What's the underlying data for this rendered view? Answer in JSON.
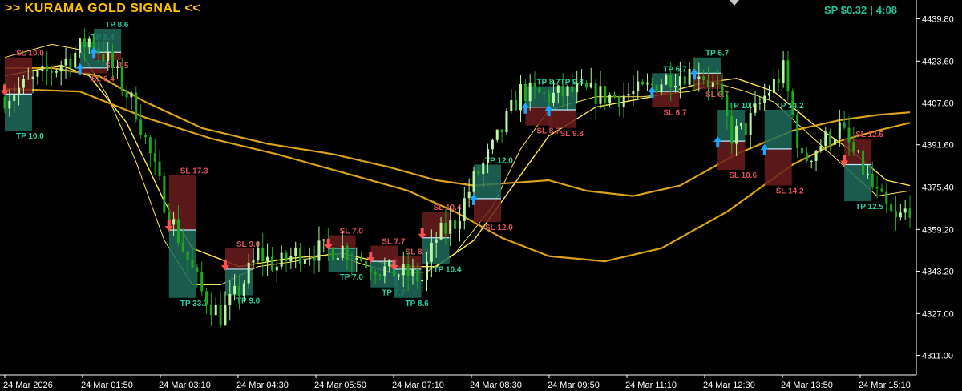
{
  "header": {
    "title": ">> KURAMA GOLD SIGNAL <<",
    "spread_label": "SP $0.32",
    "separator": "|",
    "timer": "4:08"
  },
  "colors": {
    "background": "#000000",
    "bull_candle": "#b6f7a0",
    "bear_candle": "#1fa81f",
    "tp_zone": "#1f6b5a",
    "sl_zone": "#6b1c1c",
    "tp_text": "#25d1a2",
    "sl_text": "#e0505a",
    "ma_fast": "#ffe94d",
    "ma_slow": "#d9a31a",
    "buy_arrow": "#1ea7ff",
    "sell_arrow": "#ff5050",
    "axis": "#ffffff"
  },
  "chart_data": {
    "type": "candlestick",
    "instrument": "XAUUSD",
    "x_ticks": [
      "24 Mar 2026",
      "24 Mar 01:50",
      "24 Mar 03:10",
      "24 Mar 04:30",
      "24 Mar 05:50",
      "24 Mar 07:10",
      "24 Mar 08:30",
      "24 Mar 09:50",
      "24 Mar 11:10",
      "24 Mar 12:30",
      "24 Mar 13:50",
      "24 Mar 15:10"
    ],
    "y_ticks": [
      4439.8,
      4423.6,
      4407.6,
      4391.6,
      4375.4,
      4359.2,
      4343.2,
      4327.0,
      4311.0
    ],
    "ylim": [
      4303.5,
      4447
    ],
    "n_bars": 194,
    "close_path": [
      [
        0,
        4410
      ],
      [
        8,
        4418
      ],
      [
        14,
        4425
      ],
      [
        18,
        4432
      ],
      [
        22,
        4424
      ],
      [
        28,
        4405
      ],
      [
        34,
        4370
      ],
      [
        38,
        4352
      ],
      [
        42,
        4335
      ],
      [
        46,
        4326
      ],
      [
        50,
        4336
      ],
      [
        54,
        4350
      ],
      [
        58,
        4345
      ],
      [
        62,
        4350
      ],
      [
        66,
        4351
      ],
      [
        72,
        4352
      ],
      [
        78,
        4346
      ],
      [
        82,
        4343
      ],
      [
        86,
        4342
      ],
      [
        89,
        4340
      ],
      [
        92,
        4356
      ],
      [
        96,
        4362
      ],
      [
        100,
        4378
      ],
      [
        104,
        4390
      ],
      [
        110,
        4412
      ],
      [
        116,
        4410
      ],
      [
        122,
        4412
      ],
      [
        130,
        4410
      ],
      [
        136,
        4412
      ],
      [
        142,
        4418
      ],
      [
        148,
        4420
      ],
      [
        152,
        4412
      ],
      [
        155,
        4395
      ],
      [
        158,
        4398
      ],
      [
        162,
        4410
      ],
      [
        166,
        4420
      ],
      [
        170,
        4385
      ],
      [
        174,
        4392
      ],
      [
        178,
        4398
      ],
      [
        182,
        4385
      ],
      [
        186,
        4372
      ],
      [
        190,
        4362
      ],
      [
        193,
        4368
      ]
    ],
    "series": [
      {
        "name": "MA fast",
        "values": [
          [
            0,
            4425
          ],
          [
            10,
            4430
          ],
          [
            16,
            4428
          ],
          [
            22,
            4410
          ],
          [
            28,
            4385
          ],
          [
            34,
            4355
          ],
          [
            40,
            4338
          ],
          [
            46,
            4338
          ],
          [
            54,
            4345
          ],
          [
            62,
            4347
          ],
          [
            70,
            4350
          ],
          [
            76,
            4346
          ],
          [
            84,
            4342
          ],
          [
            90,
            4343
          ],
          [
            96,
            4350
          ],
          [
            104,
            4368
          ],
          [
            110,
            4390
          ],
          [
            116,
            4405
          ],
          [
            126,
            4410
          ],
          [
            136,
            4410
          ],
          [
            146,
            4412
          ],
          [
            152,
            4415
          ],
          [
            158,
            4412
          ],
          [
            164,
            4408
          ],
          [
            170,
            4398
          ],
          [
            178,
            4385
          ],
          [
            186,
            4372
          ],
          [
            193,
            4374
          ]
        ]
      },
      {
        "name": "MA mid",
        "values": [
          [
            0,
            4418
          ],
          [
            12,
            4422
          ],
          [
            18,
            4418
          ],
          [
            26,
            4400
          ],
          [
            34,
            4370
          ],
          [
            40,
            4352
          ],
          [
            50,
            4345
          ],
          [
            60,
            4348
          ],
          [
            72,
            4350
          ],
          [
            84,
            4345
          ],
          [
            92,
            4345
          ],
          [
            100,
            4355
          ],
          [
            108,
            4375
          ],
          [
            116,
            4395
          ],
          [
            126,
            4406
          ],
          [
            138,
            4410
          ],
          [
            148,
            4415
          ],
          [
            156,
            4417
          ],
          [
            164,
            4412
          ],
          [
            172,
            4400
          ],
          [
            180,
            4390
          ],
          [
            188,
            4378
          ],
          [
            193,
            4376
          ]
        ]
      },
      {
        "name": "MA slow",
        "values": [
          [
            0,
            4421
          ],
          [
            10,
            4421
          ],
          [
            20,
            4418
          ],
          [
            30,
            4408
          ],
          [
            42,
            4398
          ],
          [
            56,
            4392
          ],
          [
            70,
            4388
          ],
          [
            82,
            4383
          ],
          [
            92,
            4378
          ],
          [
            100,
            4376
          ],
          [
            108,
            4377
          ],
          [
            116,
            4378
          ],
          [
            124,
            4374
          ],
          [
            134,
            4372
          ],
          [
            144,
            4376
          ],
          [
            156,
            4388
          ],
          [
            168,
            4397
          ],
          [
            178,
            4401
          ],
          [
            186,
            4403
          ],
          [
            193,
            4404
          ]
        ]
      },
      {
        "name": "MA long",
        "values": [
          [
            0,
            4413
          ],
          [
            16,
            4412
          ],
          [
            30,
            4402
          ],
          [
            44,
            4394
          ],
          [
            58,
            4388
          ],
          [
            72,
            4381
          ],
          [
            86,
            4374
          ],
          [
            96,
            4366
          ],
          [
            106,
            4356
          ],
          [
            116,
            4349
          ],
          [
            128,
            4347
          ],
          [
            140,
            4352
          ],
          [
            154,
            4366
          ],
          [
            168,
            4384
          ],
          [
            178,
            4393
          ],
          [
            186,
            4397
          ],
          [
            193,
            4400
          ]
        ]
      }
    ],
    "trades": [
      {
        "bar": 0,
        "dir": "sell",
        "entry": 4411,
        "tp": 4397,
        "sl": 4425,
        "tp_label": "TP 10.0",
        "sl_label": "SL 10.0"
      },
      {
        "bar": 16,
        "dir": "buy",
        "entry": 4421,
        "tp": 4431,
        "sl": 4419,
        "tp_label": "TP 8.4",
        "sl_label": "SL 6.4"
      },
      {
        "bar": 19,
        "dir": "buy",
        "entry": 4427,
        "tp": 4436,
        "sl": 4424,
        "tp_label": "TP 8.6",
        "sl_label": "SL 8.5"
      },
      {
        "bar": 35,
        "dir": "sell",
        "entry": 4359,
        "tp": 4333,
        "sl": 4380,
        "tp_label": "TP 33.7",
        "sl_label": "SL 17.3"
      },
      {
        "bar": 47,
        "dir": "sell",
        "entry": 4344,
        "tp": 4334,
        "sl": 4352,
        "tp_label": "TP 9.0",
        "sl_label": "SL 9.0"
      },
      {
        "bar": 69,
        "dir": "sell",
        "entry": 4352,
        "tp": 4343,
        "sl": 4357,
        "tp_label": "TP 7.0",
        "sl_label": "SL 7.0"
      },
      {
        "bar": 78,
        "dir": "sell",
        "entry": 4347,
        "tp": 4337,
        "sl": 4353,
        "tp_label": "TP 7.7",
        "sl_label": "SL 7.7"
      },
      {
        "bar": 83,
        "dir": "sell",
        "entry": 4344,
        "tp": 4333,
        "sl": 4349,
        "tp_label": "TP 8.6",
        "sl_label": "SL 8.3"
      },
      {
        "bar": 89,
        "dir": "sell",
        "entry": 4356,
        "tp": 4346,
        "sl": 4366,
        "tp_label": "TP 10.4",
        "sl_label": "SL 10.4"
      },
      {
        "bar": 100,
        "dir": "buy",
        "entry": 4371,
        "tp": 4384,
        "sl": 4362,
        "tp_label": "TP 12.0",
        "sl_label": "SL 12.0"
      },
      {
        "bar": 111,
        "dir": "buy",
        "entry": 4406,
        "tp": 4414,
        "sl": 4399,
        "tp_label": "TP 8.7",
        "sl_label": "SL 8.7"
      },
      {
        "bar": 116,
        "dir": "buy",
        "entry": 4405,
        "tp": 4414,
        "sl": 4398,
        "tp_label": "TP 9.8",
        "sl_label": "SL 9.8"
      },
      {
        "bar": 138,
        "dir": "buy",
        "entry": 4412,
        "tp": 4419,
        "sl": 4406,
        "tp_label": "TP 6.7",
        "sl_label": "SL 6.7"
      },
      {
        "bar": 147,
        "dir": "buy",
        "entry": 4419,
        "tp": 4425,
        "sl": 4413,
        "tp_label": "TP 6.7",
        "sl_label": "SL 6.7"
      },
      {
        "bar": 152,
        "dir": "buy",
        "entry": 4393,
        "tp": 4405,
        "sl": 4382,
        "tp_label": "TP 10.6",
        "sl_label": "SL 10.6"
      },
      {
        "bar": 162,
        "dir": "buy",
        "entry": 4390,
        "tp": 4405,
        "sl": 4376,
        "tp_label": "TP 14.2",
        "sl_label": "SL 14.2"
      },
      {
        "bar": 179,
        "dir": "sell",
        "entry": 4384,
        "tp": 4370,
        "sl": 4394,
        "tp_label": "TP 12.5",
        "sl_label": "SL 12.5"
      }
    ]
  }
}
